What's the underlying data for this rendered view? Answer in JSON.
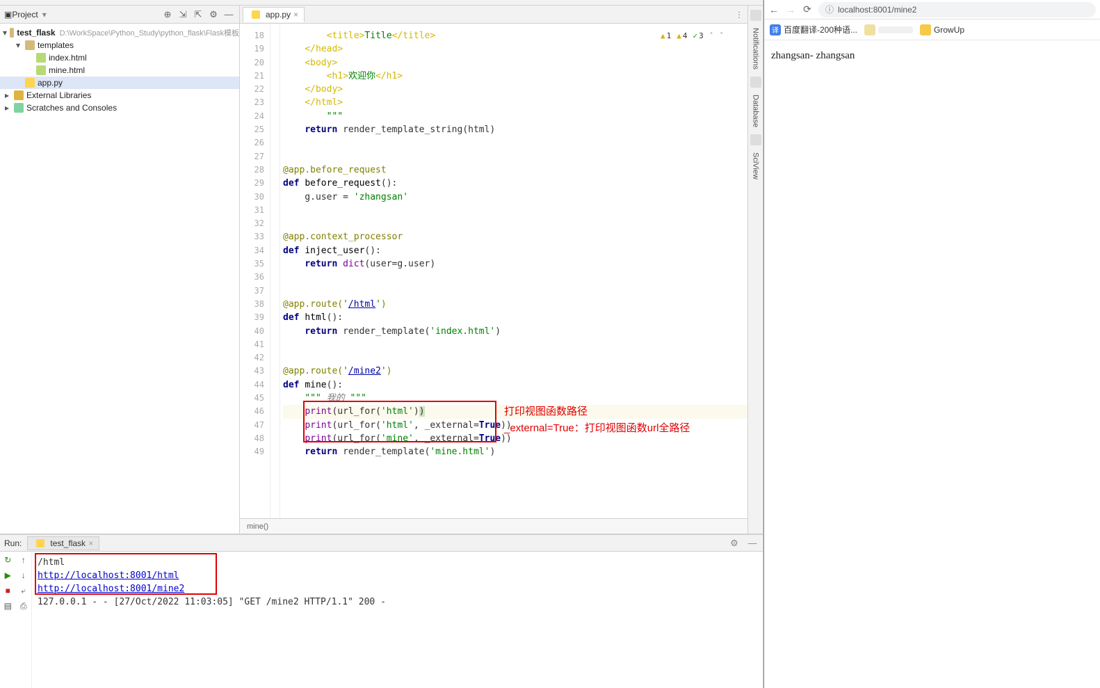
{
  "sidebar": {
    "title": "Project",
    "tree": {
      "project": "test_flask",
      "project_path": "D:\\WorkSpace\\Python_Study\\python_flask\\Flask模板",
      "templates_folder": "templates",
      "template_files": [
        "index.html",
        "mine.html"
      ],
      "app_file": "app.py",
      "ext_libs": "External Libraries",
      "scratches": "Scratches and Consoles"
    }
  },
  "editor": {
    "tab": "app.py",
    "lines_start": 18,
    "lines_end": 49,
    "breadcrumb": "mine()",
    "warnings": {
      "a": "1",
      "b": "4",
      "c": "3"
    },
    "code": {
      "l18": "        <title>Title</title>",
      "l19": "    </head>",
      "l20": "    <body>",
      "l21": "        <h1>欢迎你</h1>",
      "l22": "    </body>",
      "l23": "    </html>",
      "l24": "        \"\"\"",
      "l25": "    return render_template_string(html)",
      "l28": "@app.before_request",
      "l29": "def before_request():",
      "l30": "    g.user = 'zhangsan'",
      "l33": "@app.context_processor",
      "l34": "def inject_user():",
      "l35": "    return dict(user=g.user)",
      "l38a": "@app.route('",
      "l38b": "/html",
      "l38c": "')",
      "l39": "def html():",
      "l40": "    return render_template('index.html')",
      "l43a": "@app.route('",
      "l43b": "/mine2",
      "l43c": "')",
      "l44": "def mine():",
      "l45": "    \"\"\" 我的 \"\"\"",
      "l46": "    print(url_for('html'))",
      "l47": "    print(url_for('html', _external=True))",
      "l48": "    print(url_for('mine', _external=True))",
      "l49": "    return render_template('mine.html')"
    }
  },
  "annotation": {
    "line1": "打印视图函数路径",
    "line2": "_external=True：打印视图函数url全路径"
  },
  "run": {
    "label": "Run:",
    "tab": "test_flask",
    "console": {
      "l1": "/html",
      "l2": "http://localhost:8001/html",
      "l3": "http://localhost:8001/mine2",
      "l4": "127.0.0.1 - - [27/Oct/2022 11:03:05] \"GET /mine2 HTTP/1.1\" 200 -"
    }
  },
  "rstrip": {
    "t1": "Notifications",
    "t2": "Database",
    "t3": "SciView"
  },
  "browser": {
    "url": "localhost:8001/mine2",
    "bookmarks": {
      "b1": "百度翻译-200种语...",
      "b2": "",
      "b3": "GrowUp"
    },
    "content": "zhangsan- zhangsan"
  }
}
